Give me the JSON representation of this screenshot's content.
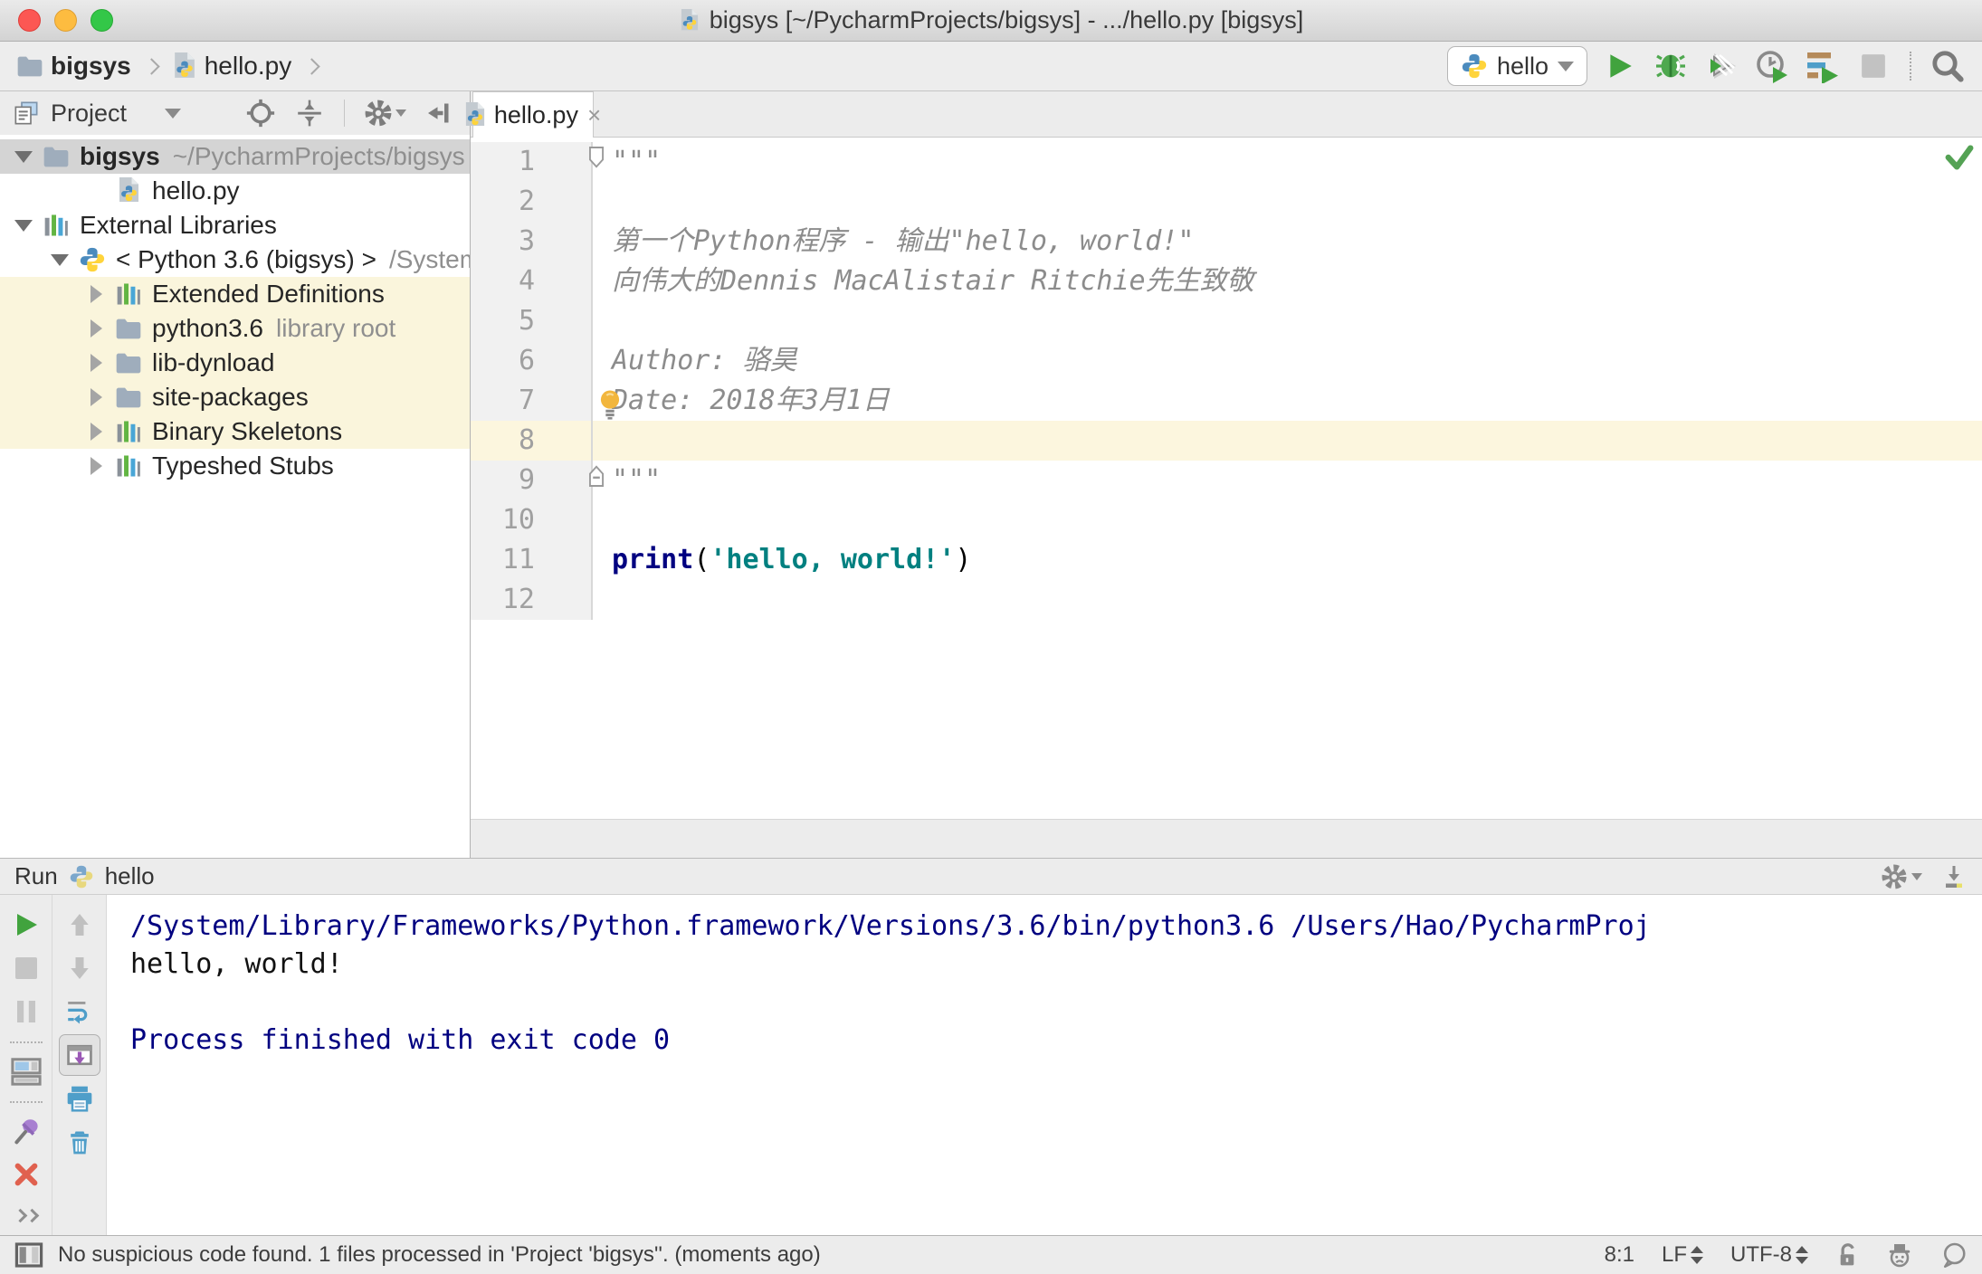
{
  "window": {
    "title": "bigsys [~/PycharmProjects/bigsys] - .../hello.py [bigsys]"
  },
  "toolbar": {
    "breadcrumbs": [
      {
        "label": "bigsys"
      },
      {
        "label": "hello.py"
      }
    ],
    "run_config": {
      "label": "hello"
    },
    "actions": [
      "run",
      "debug",
      "run-with-coverage",
      "profile",
      "concurrency-diagram",
      "stop",
      "search-everywhere"
    ]
  },
  "project_panel": {
    "title": "Project",
    "actions": [
      "locate",
      "collapse-all",
      "settings",
      "hide-panel"
    ],
    "tree": [
      {
        "indent": 0,
        "arrow": "expanded",
        "icon": "folder",
        "label": "bigsys",
        "bold": true,
        "hint": "~/PycharmProjects/bigsys",
        "selected": true
      },
      {
        "indent": 2,
        "arrow": "none",
        "icon": "pyfile",
        "label": "hello.py"
      },
      {
        "indent": 0,
        "arrow": "expanded",
        "icon": "library",
        "label": "External Libraries"
      },
      {
        "indent": 1,
        "arrow": "expanded",
        "icon": "python",
        "label": "< Python 3.6 (bigsys) >",
        "hint": "/System"
      },
      {
        "indent": 2,
        "arrow": "collapsed",
        "icon": "library",
        "label": "Extended Definitions",
        "highlighted": true
      },
      {
        "indent": 2,
        "arrow": "collapsed",
        "icon": "folder",
        "label": "python3.6",
        "hint": "library root",
        "highlighted": true
      },
      {
        "indent": 2,
        "arrow": "collapsed",
        "icon": "folder",
        "label": "lib-dynload",
        "highlighted": true
      },
      {
        "indent": 2,
        "arrow": "collapsed",
        "icon": "folder",
        "label": "site-packages",
        "highlighted": true
      },
      {
        "indent": 2,
        "arrow": "collapsed",
        "icon": "library",
        "label": "Binary Skeletons",
        "highlighted": true
      },
      {
        "indent": 2,
        "arrow": "collapsed",
        "icon": "library",
        "label": "Typeshed Stubs"
      }
    ]
  },
  "editor": {
    "tab": {
      "label": "hello.py"
    },
    "lines": [
      {
        "num": 1,
        "fold": "start",
        "segments": [
          {
            "text": "\"\"\"",
            "style": "comment"
          }
        ]
      },
      {
        "num": 2,
        "segments": []
      },
      {
        "num": 3,
        "segments": [
          {
            "text": "第一个Python程序 - 输出\"hello, world!\"",
            "style": "comment"
          }
        ]
      },
      {
        "num": 4,
        "segments": [
          {
            "text": "向伟大的Dennis MacAlistair Ritchie先生致敬",
            "style": "comment"
          }
        ]
      },
      {
        "num": 5,
        "segments": []
      },
      {
        "num": 6,
        "segments": [
          {
            "text": "Author: 骆昊",
            "style": "comment"
          }
        ]
      },
      {
        "num": 7,
        "bulb": true,
        "segments": [
          {
            "text": "Date: 2018年3月1日",
            "style": "comment"
          }
        ]
      },
      {
        "num": 8,
        "active": true,
        "segments": []
      },
      {
        "num": 9,
        "fold": "end",
        "segments": [
          {
            "text": "\"\"\"",
            "style": "comment"
          }
        ]
      },
      {
        "num": 10,
        "segments": []
      },
      {
        "num": 11,
        "segments": [
          {
            "text": "print",
            "style": "keyword"
          },
          {
            "text": "(",
            "style": "plain"
          },
          {
            "text": "'hello, world!'",
            "style": "string"
          },
          {
            "text": ")",
            "style": "plain"
          }
        ]
      },
      {
        "num": 12,
        "segments": []
      }
    ]
  },
  "run_panel": {
    "title": "Run",
    "config": "hello",
    "toolbar_left": [
      "rerun",
      "stop",
      "pause-output",
      "restore-layout",
      "pin-tab",
      "close"
    ],
    "toolbar_inner": [
      "up-stack-trace",
      "down-stack-trace",
      "soft-wrap",
      "scroll-to-end",
      "print",
      "clear-all"
    ],
    "console": [
      {
        "text": "/System/Library/Frameworks/Python.framework/Versions/3.6/bin/python3.6 /Users/Hao/PycharmProj",
        "style": "system"
      },
      {
        "text": "hello, world!",
        "style": "stdout"
      },
      {
        "text": "",
        "style": "stdout"
      },
      {
        "text": "Process finished with exit code 0",
        "style": "system"
      }
    ]
  },
  "status_bar": {
    "message": "No suspicious code found. 1 files processed in 'Project 'bigsys''. (moments ago)",
    "caret_position": "8:1",
    "line_separator": "LF",
    "encoding": "UTF-8",
    "icons": [
      "toggle-toolwindows",
      "unlock",
      "hector-inspections",
      "event-bubble"
    ]
  },
  "colors": {
    "keyword": "#000080",
    "string": "#008080",
    "comment": "#8c8c8c",
    "console_system": "#000080",
    "active_line_bg": "#fcf6de",
    "library_row_bg": "#faf5dc",
    "selected_row_bg": "#d4d4d4",
    "run_green": "#41a33e",
    "close_red": "#e0614f"
  }
}
